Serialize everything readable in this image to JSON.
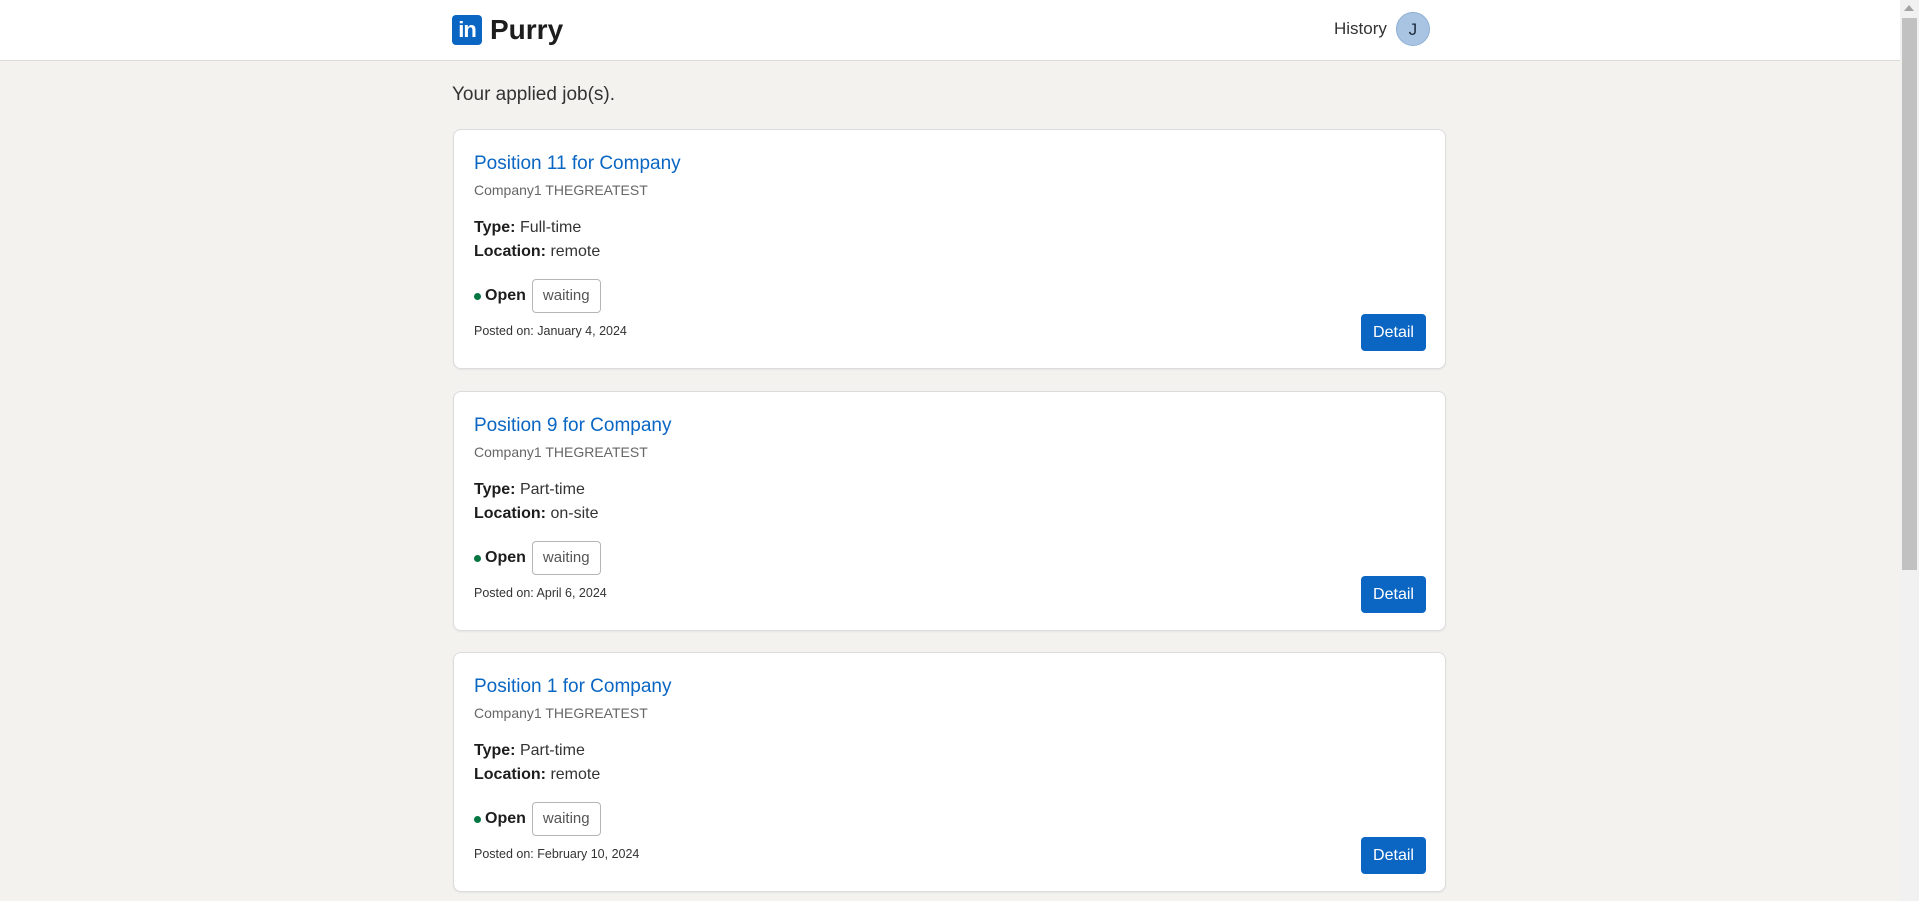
{
  "header": {
    "logo_icon_text": "in",
    "brand": "Purry",
    "history_link": "History",
    "avatar_initial": "J"
  },
  "page": {
    "heading": "Your applied job(s)."
  },
  "labels": {
    "type": "Type:",
    "location": "Location:",
    "detail_button": "Detail"
  },
  "jobs": [
    {
      "title": "Position 11 for Company",
      "company": "Company1 THEGREATEST",
      "type": "Full-time",
      "location": "remote",
      "status": "Open",
      "application_status": "waiting",
      "posted": "Posted on: January 4, 2024"
    },
    {
      "title": "Position 9 for Company",
      "company": "Company1 THEGREATEST",
      "type": "Part-time",
      "location": "on-site",
      "status": "Open",
      "application_status": "waiting",
      "posted": "Posted on: April 6, 2024"
    },
    {
      "title": "Position 1 for Company",
      "company": "Company1 THEGREATEST",
      "type": "Part-time",
      "location": "remote",
      "status": "Open",
      "application_status": "waiting",
      "posted": "Posted on: February 10, 2024"
    }
  ],
  "colors": {
    "brand_blue": "#0a66c2",
    "open_status_green": "#057642",
    "page_background": "#f3f2ef"
  }
}
